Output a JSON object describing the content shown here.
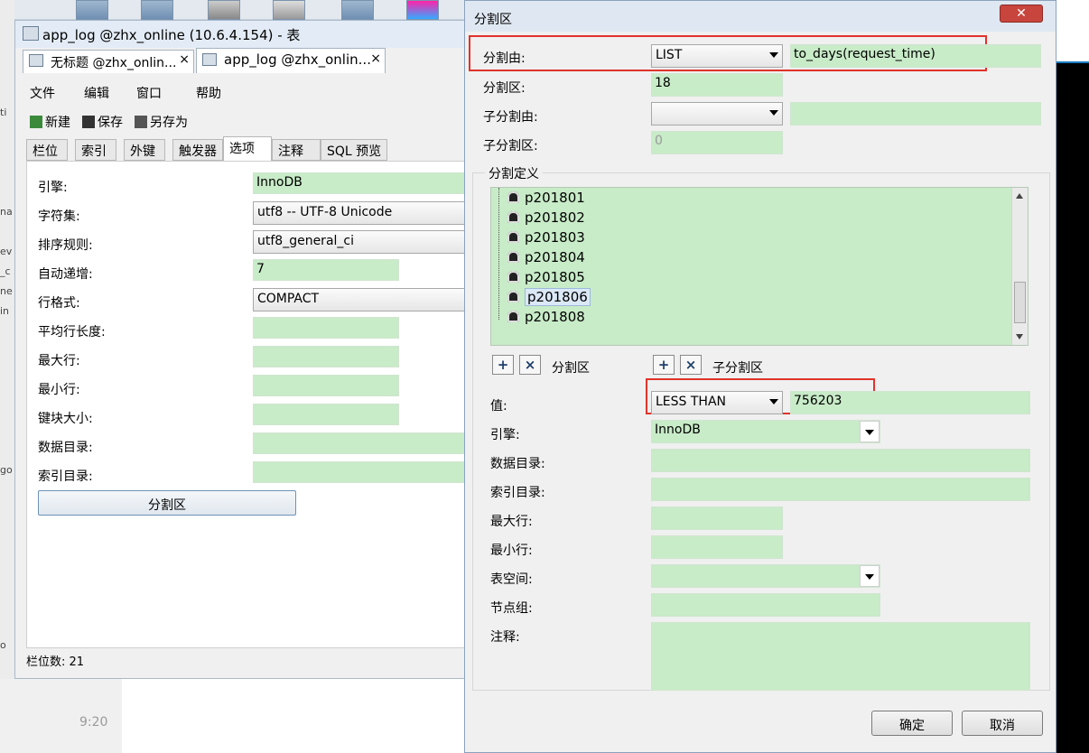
{
  "background": {
    "side_fragments": [
      "ti",
      "na",
      "ev",
      "_c",
      "ne",
      "in",
      "go",
      "o"
    ],
    "bottom_time": "9:20"
  },
  "main_window": {
    "title": "app_log @zhx_online (10.6.4.154) - 表",
    "doc_tabs": [
      {
        "label": "无标题 @zhx_onlin...",
        "close": "×"
      },
      {
        "label": "app_log @zhx_onlin...",
        "close": "×"
      }
    ],
    "menu": [
      "文件",
      "编辑",
      "窗口",
      "帮助"
    ],
    "toolbar": {
      "new": "新建",
      "save": "保存",
      "save_as": "另存为"
    },
    "tabs": [
      "栏位",
      "索引",
      "外键",
      "触发器",
      "选项",
      "注释",
      "SQL 预览"
    ],
    "active_tab": "选项",
    "options": {
      "engine_label": "引擎:",
      "engine_value": "InnoDB",
      "charset_label": "字符集:",
      "charset_value": "utf8 -- UTF-8 Unicode",
      "collation_label": "排序规则:",
      "collation_value": "utf8_general_ci",
      "auto_inc_label": "自动递增:",
      "auto_inc_value": "7",
      "row_format_label": "行格式:",
      "row_format_value": "COMPACT",
      "avg_row_len_label": "平均行长度:",
      "max_rows_label": "最大行:",
      "min_rows_label": "最小行:",
      "key_block_label": "键块大小:",
      "data_dir_label": "数据目录:",
      "index_dir_label": "索引目录:",
      "partition_button": "分割区"
    },
    "status": "栏位数: 21"
  },
  "dialog": {
    "title": "分割区",
    "close": "✕",
    "partition_by_label": "分割由:",
    "partition_by_type": "LIST",
    "partition_by_expr": "to_days(request_time)",
    "partitions_label": "分割区:",
    "partitions_value": "18",
    "subpartition_by_label": "子分割由:",
    "subpartitions_label": "子分割区:",
    "subpartitions_value": "0",
    "definition_group": "分割定义",
    "partitions": [
      "p201801",
      "p201802",
      "p201803",
      "p201804",
      "p201805",
      "p201806",
      "p201808"
    ],
    "selected_partition": "p201806",
    "add_icon": "+",
    "remove_icon": "×",
    "partition_btn_label": "分割区",
    "subpartition_btn_label": "子分割区",
    "value_label": "值:",
    "value_type": "LESS THAN",
    "value_value": "756203",
    "engine_label": "引擎:",
    "engine_value": "InnoDB",
    "data_dir_label": "数据目录:",
    "index_dir_label": "索引目录:",
    "max_rows_label": "最大行:",
    "min_rows_label": "最小行:",
    "tablespace_label": "表空间:",
    "nodegroup_label": "节点组:",
    "comment_label": "注释:",
    "ok": "确定",
    "cancel": "取消"
  },
  "colors": {
    "field_green": "#c8ebc8",
    "highlight_red": "#e0332b"
  }
}
